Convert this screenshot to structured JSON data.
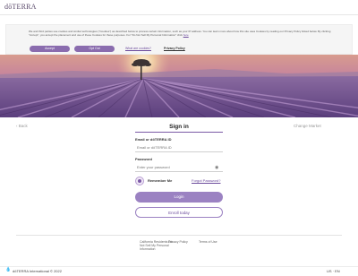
{
  "header": {
    "logo": "dōTERRA"
  },
  "cookie_banner": {
    "text": "We and third parties use cookies and similar technologies (\"Cookies\") as described below to process certain information, such as your IP address. You can learn more about how this site uses Cookies by reading our Privacy Policy linked below. By clicking \"Accept\", you accept the placement and use of these Cookies for these purposes. For \"Do Not Sell My Personal Information\" click",
    "text_link": "here",
    "accept_label": "Accept",
    "opt_out_label": "Opt Out",
    "what_cookies_label": "What are cookies?",
    "privacy_label": "Privacy Policy"
  },
  "nav": {
    "back_label": "‹ Back",
    "region_label": "Change Market"
  },
  "signin": {
    "title": "Sign in",
    "email_label": "Email or dōTERRA ID",
    "email_placeholder": "Email or dōTERRA ID",
    "password_label": "Password",
    "password_placeholder": "Enter your password",
    "remember_label": "Remember Me",
    "forgot_label": "Forgot Password?",
    "login_label": "Login",
    "enroll_label": "Enroll today"
  },
  "footer": {
    "link1": "California Residents Do Not Sell My Personal Information",
    "link2": "Privacy Policy",
    "link3": "Terms of Use",
    "copyright": "dōTERRA International © 2022",
    "locale": "US · EN"
  },
  "icons": {
    "logo": "doterra-drop-icon",
    "eye": "eye-icon",
    "back": "chevron-left-icon"
  },
  "colors": {
    "accent": "#9b82c2",
    "accent_dark": "#6b4a9b",
    "hero_sky": "#d89c8e",
    "hero_lavender": "#7a5a8f"
  }
}
